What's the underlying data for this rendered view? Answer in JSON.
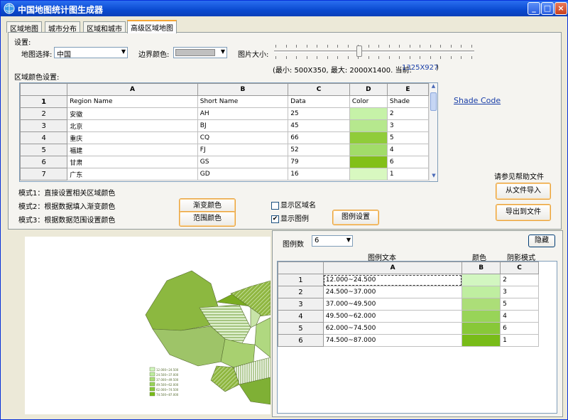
{
  "window": {
    "title": "中国地图统计图生成器"
  },
  "tabs": [
    "区域地图",
    "城市分布",
    "区域和城市",
    "高级区域地图"
  ],
  "settings": {
    "label": "设置:",
    "map_select_label": "地图选择:",
    "map_value": "中国",
    "border_color_label": "边界颜色:",
    "image_size_label": "图片大小:",
    "size_info_prefix": "(最小: 500X350, 最大: 2000X1400. 当前:",
    "size_current": "1325X927",
    "size_info_suffix": ")",
    "image_size_level": 0.42
  },
  "region_table": {
    "label": "区域颜色设置:",
    "columns": [
      "A",
      "B",
      "C",
      "D",
      "E"
    ],
    "header_row": {
      "num": "1",
      "cells": [
        "Region Name",
        "Short Name",
        "Data",
        "Color",
        "Shade"
      ]
    },
    "rows": [
      {
        "num": "2",
        "name": "安徽",
        "short": "AH",
        "data": "25",
        "color": "#c6f2a8",
        "shade": "2"
      },
      {
        "num": "3",
        "name": "北京",
        "short": "BJ",
        "data": "45",
        "color": "#b6e88e",
        "shade": "3"
      },
      {
        "num": "4",
        "name": "重庆",
        "short": "CQ",
        "data": "66",
        "color": "#90cc3a",
        "shade": "5"
      },
      {
        "num": "5",
        "name": "福建",
        "short": "FJ",
        "data": "52",
        "color": "#a2dc6a",
        "shade": "4"
      },
      {
        "num": "6",
        "name": "甘肃",
        "short": "GS",
        "data": "79",
        "color": "#82c018",
        "shade": "6"
      },
      {
        "num": "7",
        "name": "广东",
        "short": "GD",
        "data": "16",
        "color": "#d8f8c0",
        "shade": "1"
      }
    ]
  },
  "shade_code": "Shade Code",
  "modes": [
    "模式1：直接设置相关区域颜色",
    "模式2：根据数据填入渐变颜色",
    "模式3：根据数据范围设置颜色"
  ],
  "buttons": {
    "gradient": "渐变颜色",
    "range": "范围颜色",
    "legend_settings": "图例设置",
    "import": "从文件导入",
    "export": "导出到文件",
    "hide": "隐藏"
  },
  "checkboxes": [
    {
      "label": "显示区域名",
      "checked": false
    },
    {
      "label": "显示图例",
      "checked": true
    }
  ],
  "help_text": "请参见帮助文件",
  "legend": {
    "count_label": "图例数",
    "count_value": "6",
    "headers": {
      "text": "图例文本",
      "color": "颜色",
      "shade": "阴影模式"
    },
    "columns": [
      "A",
      "B",
      "C"
    ],
    "rows": [
      {
        "num": "1",
        "text": "12.000~24.500",
        "color": "#d2f6c0",
        "shade": "2"
      },
      {
        "num": "2",
        "text": "24.500~37.000",
        "color": "#bfeea0",
        "shade": "3"
      },
      {
        "num": "3",
        "text": "37.000~49.500",
        "color": "#acde78",
        "shade": "5"
      },
      {
        "num": "4",
        "text": "49.500~62.000",
        "color": "#98d458",
        "shade": "4"
      },
      {
        "num": "5",
        "text": "62.000~74.500",
        "color": "#88c838",
        "shade": "6"
      },
      {
        "num": "6",
        "text": "74.500~87.000",
        "color": "#78bc18",
        "shade": "1"
      }
    ]
  },
  "map_legend": [
    "12.000~24.500",
    "24.500~37.000",
    "37.000~49.500",
    "49.500~62.000",
    "62.000~74.500",
    "74.500~87.000"
  ]
}
